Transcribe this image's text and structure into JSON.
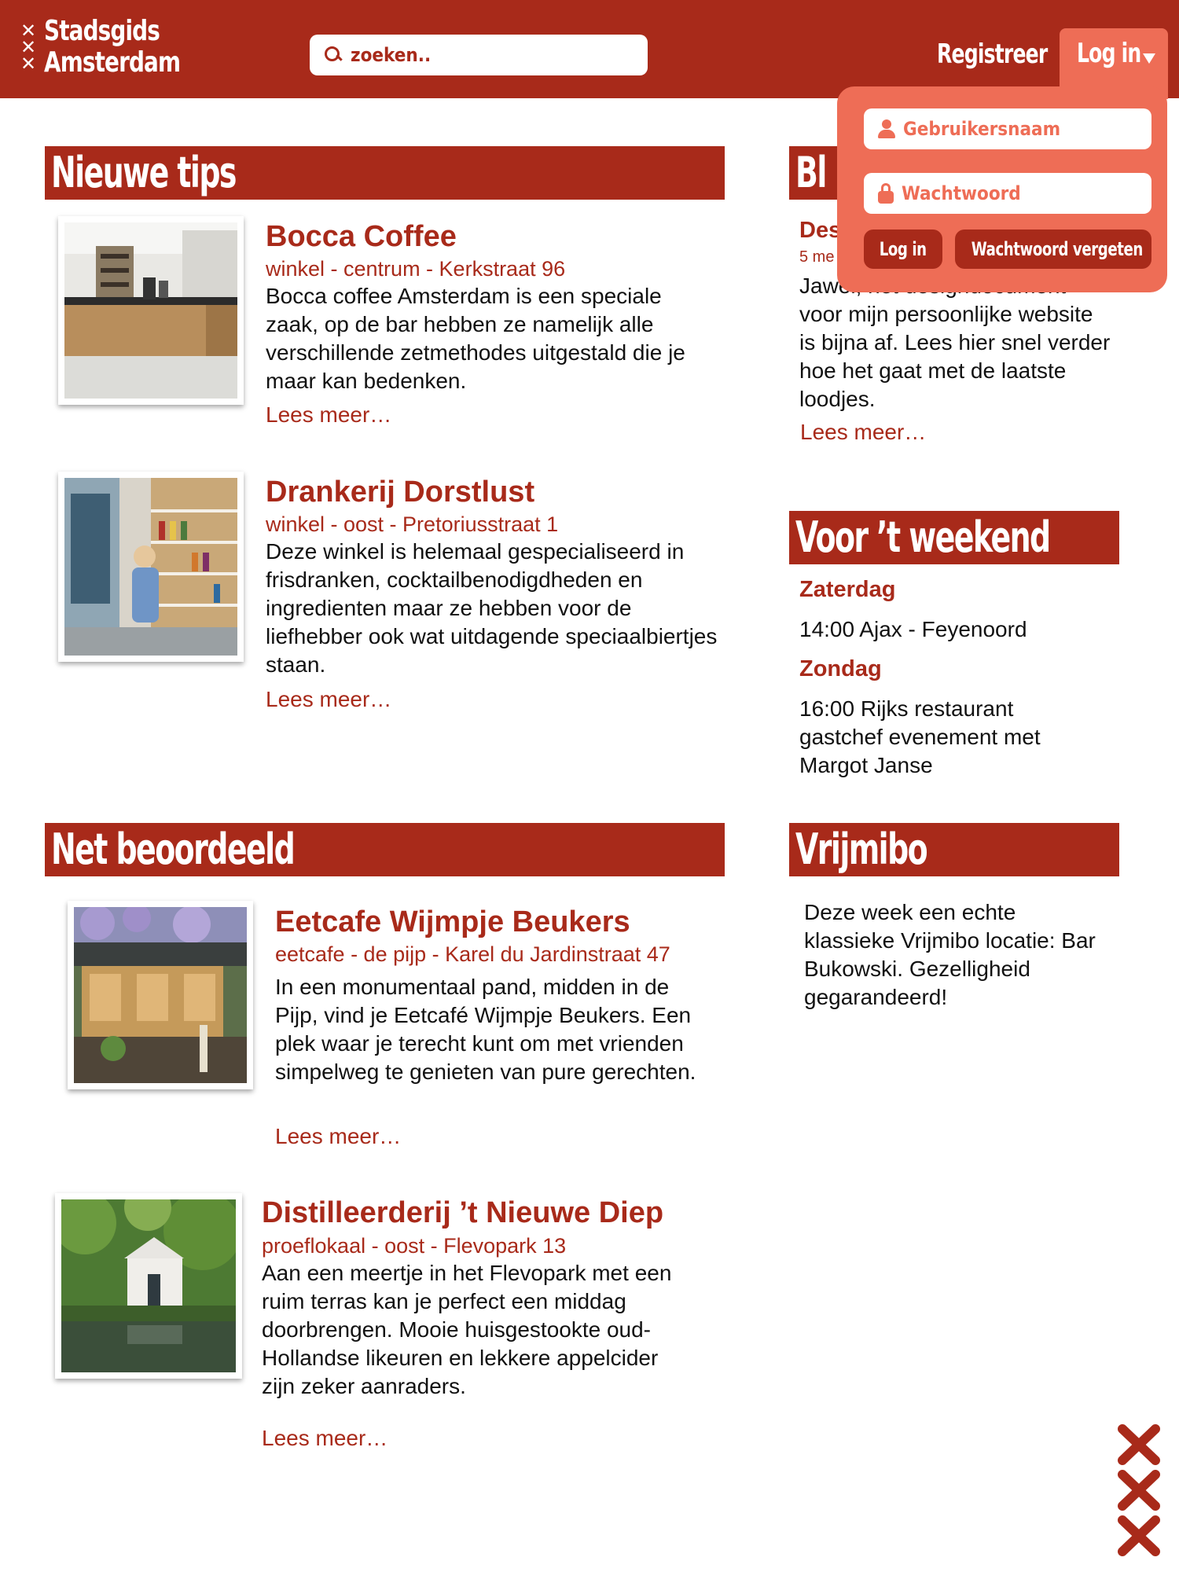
{
  "header": {
    "logo_xs": [
      "✕",
      "✕",
      "✕"
    ],
    "logo_line1": "Stadsgids",
    "logo_line2": "Amsterdam",
    "search_placeholder": "zoeken..",
    "register_label": "Registreer",
    "login_label": "Log in"
  },
  "login_dropdown": {
    "username_placeholder": "Gebruikersnaam",
    "password_placeholder": "Wachtwoord",
    "login_button": "Log in",
    "forgot_button": "Wachtwoord vergeten"
  },
  "colors": {
    "brand_red": "#a82a1a",
    "dropdown_salmon": "#ee6d56",
    "text_dark": "#111111"
  },
  "sections": {
    "new_tips_title": "Nieuwe tips",
    "blog_title": "Bl",
    "weekend_title": "Voor ’t weekend",
    "rated_title": "Net beoordeeld",
    "vrijmibo_title": "Vrijmibo"
  },
  "new_tips": [
    {
      "title": "Bocca Coffee",
      "meta": "winkel - centrum - Kerkstraat 96",
      "body": "Bocca coffee Amsterdam is een speciale zaak, op de bar hebben ze namelijk alle verschillende zetmethodes uitgestald die je maar kan bedenken.",
      "more": "Lees meer…"
    },
    {
      "title": "Drankerij Dorstlust",
      "meta": "winkel - oost - Pretoriusstraat 1",
      "body": "Deze winkel is helemaal gespecialiseerd in frisdranken, cocktailbenodigdheden en ingredienten maar ze hebben voor de liefhebber ook wat uitdagende speciaalbiertjes staan.",
      "more": "Lees meer…"
    }
  ],
  "rated": [
    {
      "title": "Eetcafe Wijmpje Beukers",
      "meta": "eetcafe - de pijp - Karel du Jardinstraat 47",
      "body": "In een monumentaal pand, midden in de Pijp, vind je Eetcafé Wijmpje Beukers. Een plek waar je terecht kunt om met vrienden simpelweg te genieten van pure gerechten.",
      "more": "Lees meer…"
    },
    {
      "title": "Distilleerderij ’t Nieuwe Diep",
      "meta": "proeflokaal - oost - Flevopark 13",
      "body": "Aan een meertje in het Flevopark met een ruim terras kan je perfect een middag doorbrengen. Mooie huisgestookte oud-Hollandse likeuren en lekkere appelcider zijn zeker aanraders.",
      "more": "Lees meer…"
    }
  ],
  "blog": {
    "title": "Des",
    "date": "5 me",
    "body": "Jawel, het designdocument voor mijn persoonlijke website is bijna af. Lees hier snel verder hoe het gaat met de laatste loodjes.",
    "more": "Lees meer…"
  },
  "weekend": {
    "day1": "Zaterdag",
    "event1": "14:00 Ajax - Feyenoord",
    "day2": "Zondag",
    "event2": "16:00 Rijks restaurant gastchef evenement met Margot Janse"
  },
  "vrijmibo": {
    "body": "Deze week een echte klassieke Vrijmibo locatie: Bar Bukowski. Gezelligheid gegarandeerd!"
  }
}
